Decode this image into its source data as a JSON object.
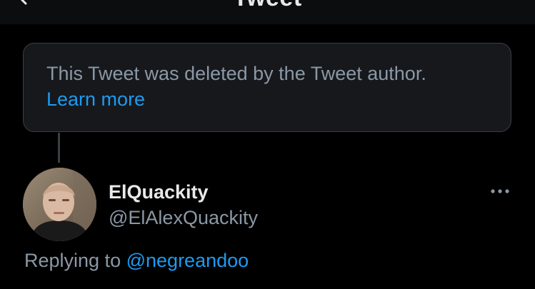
{
  "header": {
    "title": "Tweet",
    "back_icon": "chevron-left-icon"
  },
  "deleted_notice": {
    "text": "This Tweet was deleted by the Tweet author.",
    "link_label": "Learn more"
  },
  "tweet": {
    "display_name": "ElQuackity",
    "username": "@ElAlexQuackity",
    "more_icon": "more-horizontal-icon",
    "replying_prefix": "Replying to",
    "replying_to": "@negreandoo"
  },
  "colors": {
    "background": "#000000",
    "card": "#16181c",
    "border": "#3a3f44",
    "primary_text": "#e7e9ea",
    "secondary_text": "#8b98a5",
    "link": "#1d9bf0"
  }
}
